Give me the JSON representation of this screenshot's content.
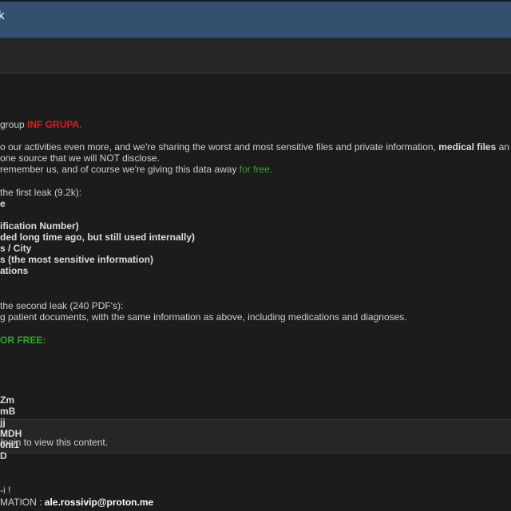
{
  "header": {
    "title": "k"
  },
  "post": {
    "p1": {
      "pre": "group ",
      "name": "INF GRUPA."
    },
    "p2": {
      "l1_pre": "o our activities even more, and we're sharing the worst and most sensitive files and private information, ",
      "l1_bold": "medical files",
      "l1_post": " an",
      "l2": "one source that we will NOT disclose.",
      "l3_pre": " remember us, and of course we're giving this data away ",
      "l3_green": "for free."
    },
    "first_leak": {
      "heading": "the first leak (9.2k):",
      "items": [
        "e",
        "",
        "ification Number)",
        "ded long time ago, but still used internally)",
        "s / City",
        "s (the most sensitive information)",
        "ations"
      ]
    },
    "second_leak": {
      "heading": "the second leak (240 PDF's):",
      "desc": "g patient documents, with the same information as above, including medications and diagnoses."
    },
    "free_label": "OR FREE:",
    "hidden_notice": "login to view this content.",
    "codes": [
      "Zm",
      "mB",
      "jj",
      "MDH",
      "0m1",
      "D"
    ],
    "signoff": "-i !",
    "contact": {
      "label": "MATION : ",
      "email": "ale.rossivip@proton.me"
    }
  }
}
